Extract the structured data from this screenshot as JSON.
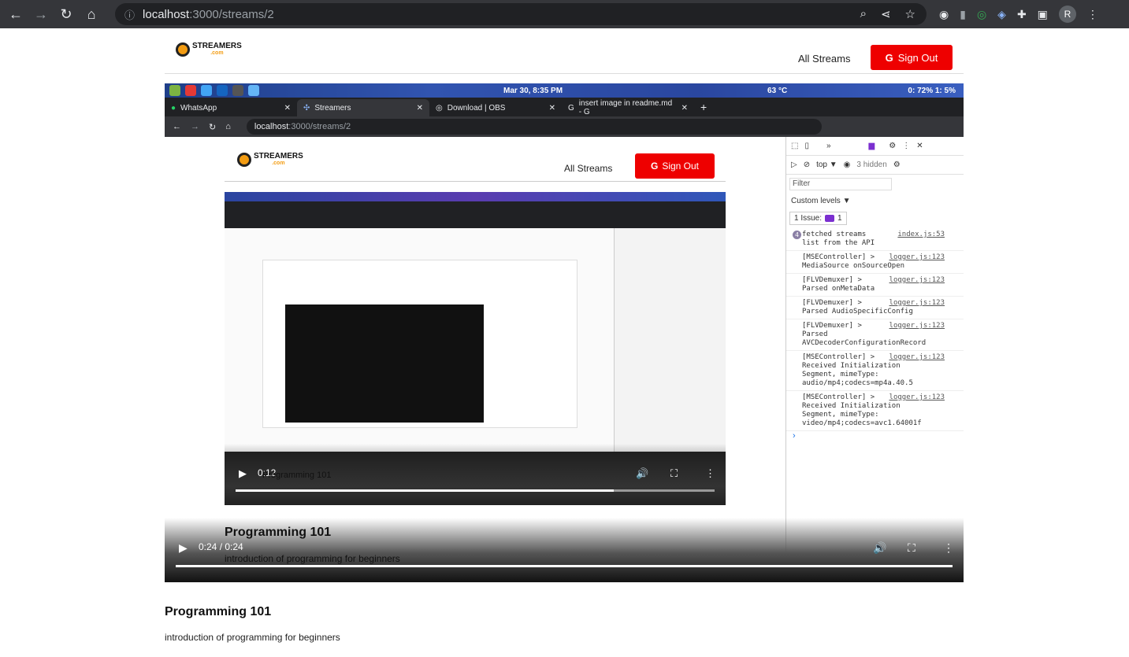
{
  "browser": {
    "url_host": "localhost",
    "url_path": ":3000/streams/2",
    "avatar": "R",
    "icons": [
      "back-icon",
      "forward-icon",
      "reload-icon",
      "home-icon",
      "zoom-icon",
      "share-icon",
      "star-icon",
      "extensions-icon",
      "sidepanel-icon",
      "menu-icon"
    ]
  },
  "header": {
    "logo_main": "STREAMERS",
    "logo_sub": ".com",
    "all_streams": "All Streams",
    "sign_out": "Sign Out",
    "google_glyph": "G"
  },
  "desktop": {
    "clock": "Mar 30,  8:35 PM",
    "temp": "63 °C",
    "battery": "0: 72%  1: 5%",
    "tabs": [
      {
        "label": "WhatsApp",
        "close": "✕"
      },
      {
        "label": "Streamers",
        "close": "✕"
      },
      {
        "label": "Download | OBS",
        "close": "✕"
      },
      {
        "label": "insert image in readme.md - G",
        "close": "✕"
      }
    ],
    "url_host": "localhost",
    "url_path": ":3000/streams/2"
  },
  "inner": {
    "all_streams": "All Streams",
    "sign_out": "Sign Out",
    "nested_time": "0:12",
    "nested_title": "Programming 101",
    "nested_progress": 0.79
  },
  "devtools": {
    "top": "top ▼",
    "hidden": "3 hidden",
    "filter": "Filter",
    "custom_levels": "Custom levels ▼",
    "issue": "1 Issue:",
    "issue_count": "1",
    "logs": [
      {
        "count": "4",
        "text": "fetched streams\nlist from the API",
        "src": "index.js:53"
      },
      {
        "count": "",
        "text": "[MSEController] >\nMediaSource onSourceOpen",
        "src": "logger.js:123"
      },
      {
        "count": "",
        "text": "[FLVDemuxer] >\nParsed onMetaData",
        "src": "logger.js:123"
      },
      {
        "count": "",
        "text": "[FLVDemuxer] >\nParsed AudioSpecificConfig",
        "src": "logger.js:123"
      },
      {
        "count": "",
        "text": "[FLVDemuxer] >\nParsed\nAVCDecoderConfigurationRecord",
        "src": "logger.js:123"
      },
      {
        "count": "",
        "text": "[MSEController] >\nReceived Initialization\nSegment, mimeType:\naudio/mp4;codecs=mp4a.40.5",
        "src": "logger.js:123"
      },
      {
        "count": "",
        "text": "[MSEController] >\nReceived Initialization\nSegment, mimeType:\nvideo/mp4;codecs=avc1.64001f",
        "src": "logger.js:123"
      }
    ],
    "prompt": "›"
  },
  "player": {
    "time": "0:24 / 0:24",
    "overlay_title": "Programming 101",
    "overlay_sub": "introduction of programming for beginners",
    "progress": 1.0
  },
  "stream": {
    "title": "Programming 101",
    "description": "introduction of programming for beginners"
  }
}
